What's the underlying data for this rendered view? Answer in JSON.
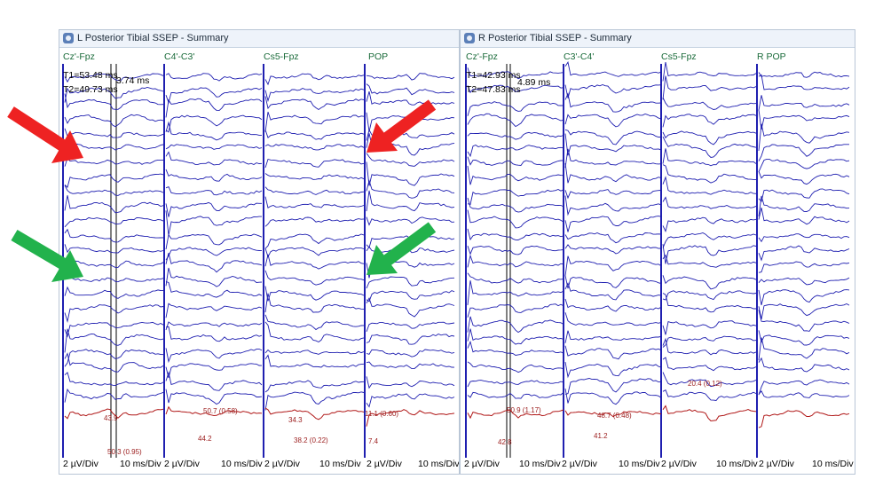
{
  "colors": {
    "trace": "#1f1fb0",
    "avg_trace": "#b01818",
    "label": "#1a6b3a",
    "marker": "#9b1c1c",
    "cursor": "#000000",
    "arrow_red": "#ee2222",
    "arrow_green": "#22b24c"
  },
  "arrows": [
    {
      "color": "red",
      "direction": "down-right",
      "icon": "red-arrow-icon"
    },
    {
      "color": "red",
      "direction": "down-left",
      "icon": "red-arrow-icon"
    },
    {
      "color": "green",
      "direction": "down-right",
      "icon": "green-arrow-icon"
    },
    {
      "color": "green",
      "direction": "down-left",
      "icon": "green-arrow-icon"
    }
  ],
  "panels": [
    {
      "id": "left",
      "title": "L Posterior Tibial SSEP - Summary",
      "channels": [
        "Cz'-Fpz",
        "C4'-C3'",
        "Cs5-Fpz",
        "POP"
      ],
      "cursor_readout": {
        "t1": "T1=53.48 ms",
        "t2": "T2=49.73 ms",
        "diff": "3.74 ms"
      },
      "footer": [
        "2 µV/Div",
        "10 ms/Div",
        "2 µV/Div",
        "10 ms/Div",
        "2 µV/Div",
        "10 ms/Div",
        "2 µV/Div",
        "10 ms/Div"
      ],
      "marker_labels": [
        "43.9",
        "50.3 (0.95)",
        "50.7 (0.58)",
        "44.2",
        "34.3",
        "38.2 (0.22)",
        "11.1 (0.60)",
        "7.4"
      ]
    },
    {
      "id": "right",
      "title": "R Posterior Tibial SSEP - Summary",
      "channels": [
        "Cz'-Fpz",
        "C3'-C4'",
        "Cs5-Fpz",
        "R POP"
      ],
      "cursor_readout": {
        "t1": "T1=42.93 ms",
        "t2": "T2=47.83 ms",
        "diff": "4.89 ms"
      },
      "footer": [
        "2 µV/Div",
        "10 ms/Div",
        "2 µV/Div",
        "10 ms/Div",
        "2 µV/Div",
        "10 ms/Div",
        "2 µV/Div",
        "10 ms/Div"
      ],
      "marker_labels": [
        "50.9 (1.17)",
        "42.8",
        "48.7 (0.48)",
        "41.2",
        "20.4 (0.12)"
      ]
    }
  ],
  "chart_data": {
    "type": "line",
    "panels": [
      {
        "title": "L Posterior Tibial SSEP - Summary",
        "channels": [
          "Cz'-Fpz",
          "C4'-C3'",
          "Cs5-Fpz",
          "POP"
        ],
        "sensitivity": "2 µV/Div",
        "timebase": "10 ms/Div",
        "cursors": {
          "T1": 53.48,
          "T2": 49.73,
          "delta": 3.74
        },
        "traces_per_channel": 24
      },
      {
        "title": "R Posterior Tibial SSEP - Summary",
        "channels": [
          "Cz'-Fpz",
          "C3'-C4'",
          "Cs5-Fpz",
          "R POP"
        ],
        "sensitivity": "2 µV/Div",
        "timebase": "10 ms/Div",
        "cursors": {
          "T1": 42.93,
          "T2": 47.83,
          "delta": 4.89
        },
        "traces_per_channel": 24
      }
    ]
  }
}
